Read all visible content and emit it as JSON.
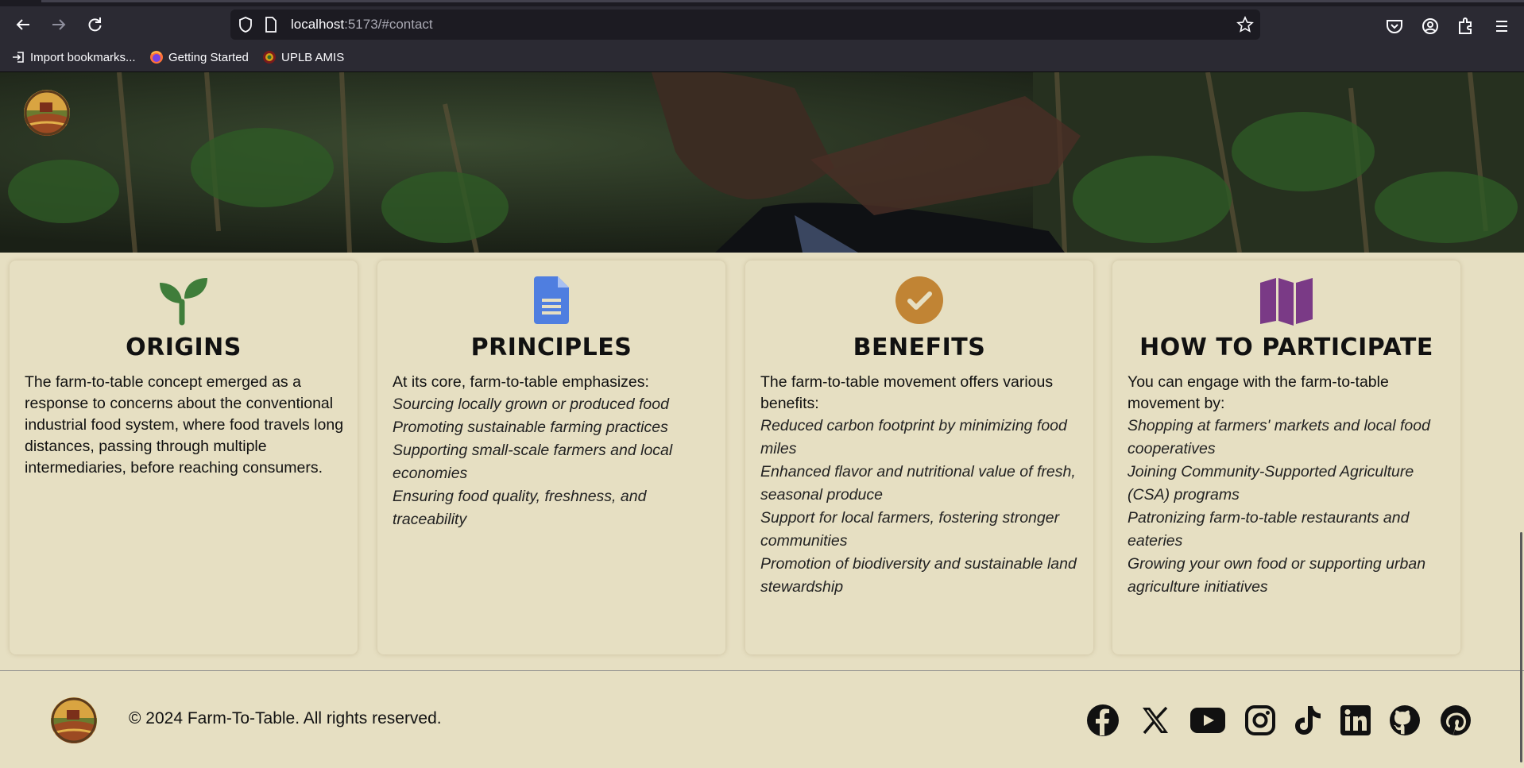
{
  "browser": {
    "url_host": "localhost",
    "url_rest": ":5173/#contact",
    "bookmarks": [
      {
        "label": "Import bookmarks..."
      },
      {
        "label": "Getting Started"
      },
      {
        "label": "UPLB AMIS"
      }
    ]
  },
  "cards": [
    {
      "title": "ORIGINS",
      "icon": "sprout-icon",
      "color": "#3f7d3a",
      "intro": "The farm-to-table concept emerged as a response to concerns about the conventional industrial food system, where food travels long distances, passing through multiple intermediaries, before reaching consumers.",
      "items": []
    },
    {
      "title": "PRINCIPLES",
      "icon": "document-icon",
      "color": "#4f7ee0",
      "intro": "At its core, farm-to-table emphasizes:",
      "items": [
        "Sourcing locally grown or produced food",
        "Promoting sustainable farming practices",
        "Supporting small-scale farmers and local economies",
        "Ensuring food quality, freshness, and traceability"
      ]
    },
    {
      "title": "BENEFITS",
      "icon": "check-circle-icon",
      "color": "#c18434",
      "intro": "The farm-to-table movement offers various benefits:",
      "items": [
        "Reduced carbon footprint by minimizing food miles",
        "Enhanced flavor and nutritional value of fresh, seasonal produce",
        "Support for local farmers, fostering stronger communities",
        "Promotion of biodiversity and sustainable land stewardship"
      ]
    },
    {
      "title": "HOW TO PARTICIPATE",
      "icon": "map-icon",
      "color": "#7a3a86",
      "intro": "You can engage with the farm-to-table movement by:",
      "items": [
        "Shopping at farmers' markets and local food cooperatives",
        "Joining Community-Supported Agriculture (CSA) programs",
        "Patronizing farm-to-table restaurants and eateries",
        "Growing your own food or supporting urban agriculture initiatives"
      ]
    }
  ],
  "footer": {
    "copyright": "© 2024 Farm-To-Table. All rights reserved.",
    "social": [
      "facebook-icon",
      "x-icon",
      "youtube-icon",
      "instagram-icon",
      "tiktok-icon",
      "linkedin-icon",
      "github-icon",
      "pinterest-icon"
    ]
  }
}
